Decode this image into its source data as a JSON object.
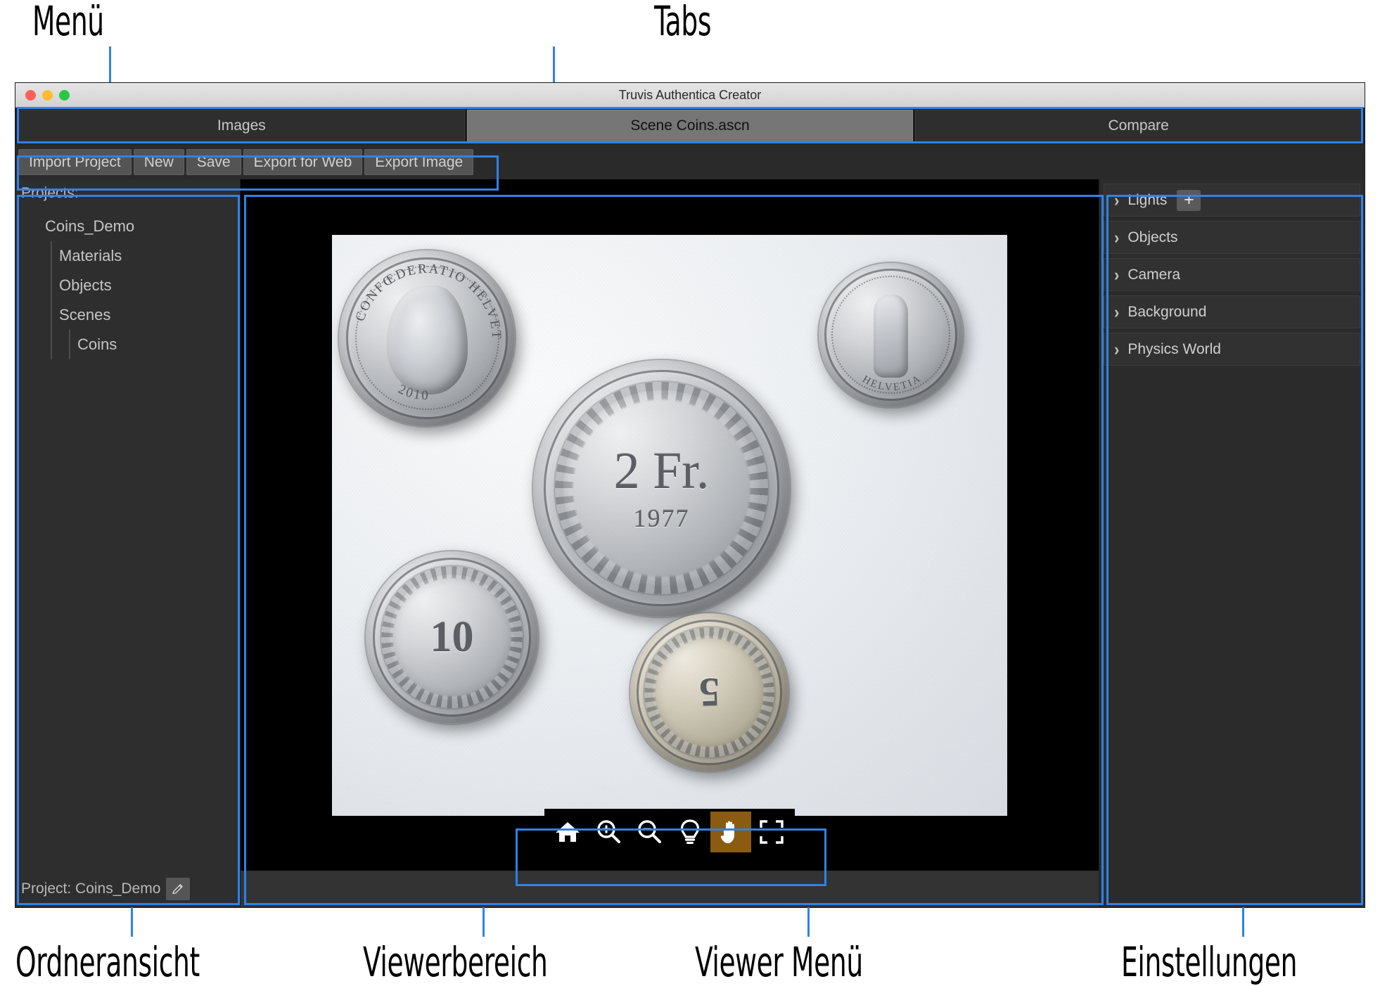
{
  "annotations": {
    "menu": "Menü",
    "tabs": "Tabs",
    "folder_view": "Ordneransicht",
    "viewer_area": "Viewerbereich",
    "viewer_menu": "Viewer Menü",
    "settings": "Einstellungen",
    "accent_color": "#2f82e8"
  },
  "window": {
    "title": "Truvis Authentica Creator",
    "traffic_lights": [
      "close-red",
      "minimize-yellow",
      "zoom-green"
    ]
  },
  "tabs": [
    {
      "label": "Images",
      "active": false
    },
    {
      "label": "Scene Coins.ascn",
      "active": true
    },
    {
      "label": "Compare",
      "active": false
    }
  ],
  "menu": {
    "buttons": [
      {
        "label": "Import Project"
      },
      {
        "label": "New"
      },
      {
        "label": "Save"
      },
      {
        "label": "Export for Web"
      },
      {
        "label": "Export Image"
      }
    ]
  },
  "left_panel": {
    "header": "Projects:",
    "tree": [
      {
        "label": "Coins_Demo",
        "level": 0
      },
      {
        "label": "Materials",
        "level": 1
      },
      {
        "label": "Objects",
        "level": 1
      },
      {
        "label": "Scenes",
        "level": 1
      },
      {
        "label": "Coins",
        "level": 2
      }
    ],
    "status": "Project: Coins_Demo",
    "edit_icon": "pencil-icon"
  },
  "viewer": {
    "background_color": "#000000",
    "toolbar": [
      {
        "name": "home-icon",
        "label": "Home",
        "active": false
      },
      {
        "name": "zoom-in-icon",
        "label": "Zoom In",
        "active": false
      },
      {
        "name": "zoom-out-icon",
        "label": "Zoom Out",
        "active": false
      },
      {
        "name": "light-bulb-icon",
        "label": "Light",
        "active": false
      },
      {
        "name": "hand-icon",
        "label": "Pan",
        "active": true
      },
      {
        "name": "fullscreen-icon",
        "label": "Fullscreen",
        "active": false
      }
    ],
    "active_tool_color": "#8a5b10",
    "photo": {
      "description": "Five Swiss coins on white paper",
      "coins": [
        {
          "id": "5-rappen-obverse",
          "legend_top": "CONFŒDERATIO",
          "legend_right": "HELVETICA",
          "year": "2010"
        },
        {
          "id": "2-franken-reverse",
          "denomination": "2 Fr.",
          "year": "1977"
        },
        {
          "id": "helvetia-standing",
          "legend": "HELVETIA"
        },
        {
          "id": "10-rappen-reverse",
          "denomination": "10"
        },
        {
          "id": "5-rappen-reverse",
          "denomination": "5"
        }
      ]
    }
  },
  "right_panel": {
    "sections": [
      {
        "label": "Lights",
        "expanded": false,
        "has_add": true,
        "add_label": "+"
      },
      {
        "label": "Objects",
        "expanded": false,
        "has_add": false
      },
      {
        "label": "Camera",
        "expanded": false,
        "has_add": false
      },
      {
        "label": "Background",
        "expanded": false,
        "has_add": false
      },
      {
        "label": "Physics World",
        "expanded": false,
        "has_add": false
      }
    ],
    "chevron_icon": "chevron-right-icon"
  }
}
